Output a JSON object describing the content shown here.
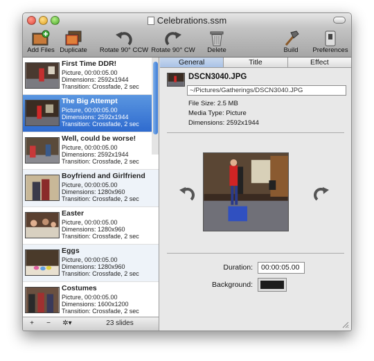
{
  "window": {
    "title": "Celebrations.ssm"
  },
  "toolbar": {
    "add_files": "Add Files",
    "duplicate": "Duplicate",
    "rotate_ccw": "Rotate 90° CCW",
    "rotate_cw": "Rotate 90° CW",
    "delete": "Delete",
    "build": "Build",
    "preferences": "Preferences"
  },
  "slides": [
    {
      "title": "First Time DDR!",
      "type": "Picture, 00:00:05.00",
      "dimensions": "Dimensions: 2592x1944",
      "transition": "Transition: Crossfade, 2 sec"
    },
    {
      "title": "The Big Attempt",
      "type": "Picture, 00:00:05.00",
      "dimensions": "Dimensions: 2592x1944",
      "transition": "Transition: Crossfade, 2 sec"
    },
    {
      "title": "Well, could be worse!",
      "type": "Picture, 00:00:05.00",
      "dimensions": "Dimensions: 2592x1944",
      "transition": "Transition: Crossfade, 2 sec"
    },
    {
      "title": "Boyfriend and Girlfriend",
      "type": "Picture, 00:00:05.00",
      "dimensions": "Dimensions: 1280x960",
      "transition": "Transition: Crossfade, 2 sec"
    },
    {
      "title": "Easter",
      "type": "Picture, 00:00:05.00",
      "dimensions": "Dimensions: 1280x960",
      "transition": "Transition: Crossfade, 2 sec"
    },
    {
      "title": "Eggs",
      "type": "Picture, 00:00:05.00",
      "dimensions": "Dimensions: 1280x960",
      "transition": "Transition: Crossfade, 2 sec"
    },
    {
      "title": "Costumes",
      "type": "Picture, 00:00:05.00",
      "dimensions": "Dimensions: 1600x1200",
      "transition": "Transition: Crossfade, 2 sec"
    }
  ],
  "list_footer": {
    "add": "+",
    "remove": "−",
    "action": "✲▾",
    "count": "23 slides"
  },
  "tabs": [
    "General",
    "Title",
    "Effect"
  ],
  "detail": {
    "file_name": "DSCN3040.JPG",
    "path": "~/Pictures/Gatherings/DSCN3040.JPG",
    "file_size": "File Size: 2.5 MB",
    "media_type": "Media Type: Picture",
    "dimensions": "Dimensions: 2592x1944",
    "duration_label": "Duration:",
    "duration_value": "00:00:05.00",
    "background_label": "Background:",
    "background_color": "#1c1c1c"
  },
  "colors": {
    "selection": "#3a78d8",
    "alt_row": "#eef3f9"
  }
}
